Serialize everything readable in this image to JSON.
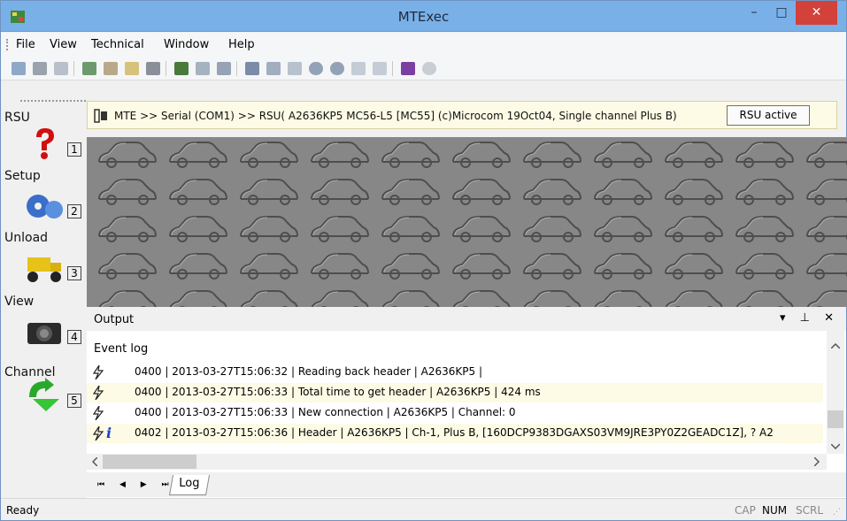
{
  "window": {
    "title": "MTExec",
    "minimize": "–",
    "maximize": "□",
    "close": "✕"
  },
  "menu": [
    {
      "label": "File"
    },
    {
      "label": "View"
    },
    {
      "label": "Technical"
    },
    {
      "label": "Window"
    },
    {
      "label": "Help"
    }
  ],
  "toolbar_icons": [
    "save-icon",
    "print-icon",
    "print-preview-icon",
    "tree-icon",
    "edit-icon",
    "open-folder-icon",
    "disk-icon",
    "notes-icon",
    "share-icon",
    "cloud-icon",
    "lookup-icon",
    "zoom-icon",
    "resize-icon",
    "back-icon",
    "forward-icon",
    "stop-icon",
    "refresh-icon",
    "book-icon",
    "help-icon"
  ],
  "sidebar": {
    "items": [
      {
        "label": "RSU",
        "num": "1",
        "icon": "question-icon"
      },
      {
        "label": "Setup",
        "num": "2",
        "icon": "gears-icon"
      },
      {
        "label": "Unload",
        "num": "3",
        "icon": "dump-truck-icon"
      },
      {
        "label": "View",
        "num": "4",
        "icon": "camera-icon"
      },
      {
        "label": "Channel",
        "num": "5",
        "icon": "green-arrow-icon"
      }
    ]
  },
  "connection": {
    "path": "MTE >> Serial (COM1) >> RSU( A2636KP5 MC56-L5 [MC55] (c)Microcom 19Oct04, Single channel Plus B)",
    "status_button": "RSU active"
  },
  "output": {
    "title": "Output",
    "controls": "▾ ⊥ ✕",
    "log_title": "Event log",
    "rows": [
      {
        "text": "0400 | 2013-03-27T15:06:32 | Reading back header | A2636KP5 |",
        "info": false,
        "highlight": false
      },
      {
        "text": "0400 | 2013-03-27T15:06:33 | Total time to get header | A2636KP5 | 424 ms",
        "info": false,
        "highlight": true
      },
      {
        "text": "0400 | 2013-03-27T15:06:33 | New connection | A2636KP5 | Channel: 0",
        "info": false,
        "highlight": false
      },
      {
        "text": "0402 | 2013-03-27T15:06:36 | Header | A2636KP5 | Ch-1, Plus B, [160DCP9383DGAXS03VM9JRE3PY0Z2GEADC1Z], ? A2",
        "info": true,
        "highlight": true
      }
    ],
    "tab_nav": "⏮ ◀ ▶ ⏭",
    "tab_label": "Log"
  },
  "status": {
    "text": "Ready",
    "indicators": [
      {
        "label": "CAP",
        "on": false
      },
      {
        "label": "NUM",
        "on": true
      },
      {
        "label": "SCRL",
        "on": false
      }
    ]
  },
  "colors": {
    "titlebar": "#7ab0e8",
    "close": "#d2413a",
    "background": "#878787",
    "highlight_row": "#fdfbe5"
  }
}
